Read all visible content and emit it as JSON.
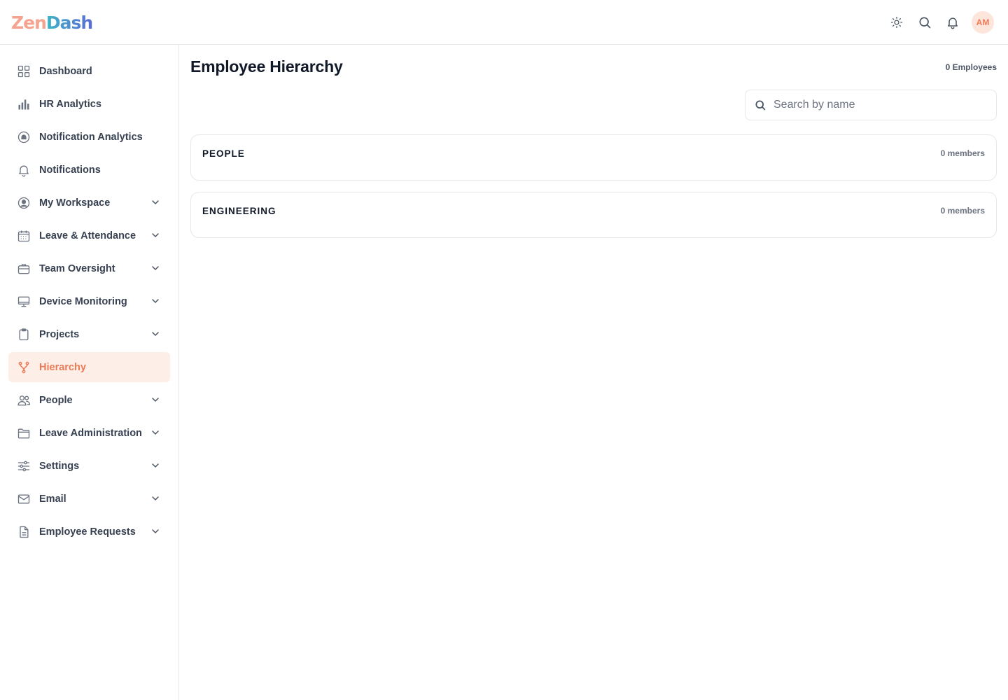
{
  "brand": {
    "name_part1": "Zen",
    "name_part2": "Dash",
    "accent": "#ee7a55"
  },
  "header": {
    "actions": [
      {
        "name": "theme-toggle",
        "icon": "sun-icon"
      },
      {
        "name": "search",
        "icon": "search-icon"
      },
      {
        "name": "notifications",
        "icon": "bell-icon"
      }
    ],
    "avatar_initials": "AM"
  },
  "sidebar": {
    "items": [
      {
        "label": "Dashboard",
        "icon": "grid-icon",
        "expandable": false
      },
      {
        "label": "HR Analytics",
        "icon": "bar-chart-icon",
        "expandable": false
      },
      {
        "label": "Notification Analytics",
        "icon": "notification-analytics-icon",
        "expandable": false
      },
      {
        "label": "Notifications",
        "icon": "bell-icon",
        "expandable": false
      },
      {
        "label": "My Workspace",
        "icon": "user-circle-icon",
        "expandable": true
      },
      {
        "label": "Leave & Attendance",
        "icon": "calendar-icon",
        "expandable": true
      },
      {
        "label": "Team Oversight",
        "icon": "briefcase-icon",
        "expandable": true
      },
      {
        "label": "Device Monitoring",
        "icon": "monitor-icon",
        "expandable": true
      },
      {
        "label": "Projects",
        "icon": "clipboard-icon",
        "expandable": true
      },
      {
        "label": "Hierarchy",
        "icon": "hierarchy-icon",
        "expandable": false,
        "active": true
      },
      {
        "label": "People",
        "icon": "users-icon",
        "expandable": true
      },
      {
        "label": "Leave Administration",
        "icon": "folder-icon",
        "expandable": true
      },
      {
        "label": "Settings",
        "icon": "sliders-icon",
        "expandable": true
      },
      {
        "label": "Email",
        "icon": "mail-icon",
        "expandable": true
      },
      {
        "label": "Employee Requests",
        "icon": "document-icon",
        "expandable": true
      }
    ]
  },
  "main": {
    "title": "Employee Hierarchy",
    "employee_count": "0 Employees",
    "search": {
      "placeholder": "Search by name",
      "value": ""
    },
    "groups": [
      {
        "name": "PEOPLE",
        "count": "0 members"
      },
      {
        "name": "ENGINEERING",
        "count": "0 members"
      }
    ]
  }
}
